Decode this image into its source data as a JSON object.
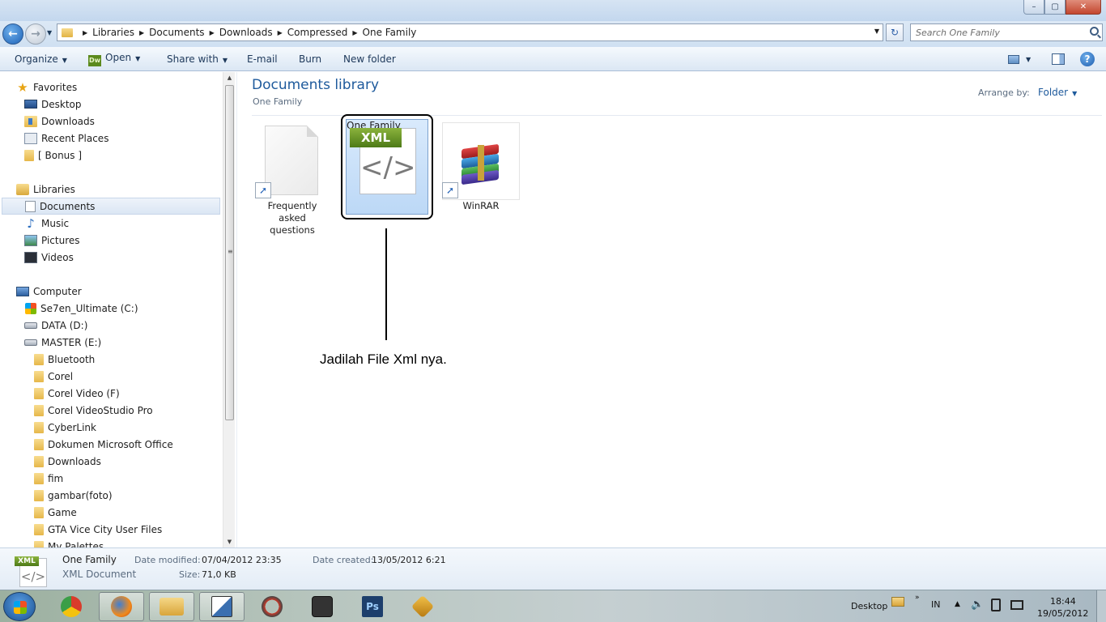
{
  "window": {
    "controls": {
      "minimize": "–",
      "maximize": "▢",
      "close": "✕"
    }
  },
  "address": {
    "breadcrumbs": [
      "Libraries",
      "Documents",
      "Downloads",
      "Compressed",
      "One Family"
    ],
    "search_placeholder": "Search One Family"
  },
  "toolbar": {
    "organize": "Organize",
    "open_icon_text": "Dw",
    "open": "Open",
    "share_with": "Share with",
    "email": "E-mail",
    "burn": "Burn",
    "new_folder": "New folder",
    "help": "?"
  },
  "sidebar": {
    "favorites": {
      "label": "Favorites",
      "items": [
        {
          "label": "Desktop",
          "icon": "desktop-icon"
        },
        {
          "label": "Downloads",
          "icon": "downloads-folder-icon"
        },
        {
          "label": "Recent Places",
          "icon": "recent-places-icon"
        },
        {
          "label": "[ Bonus ]",
          "icon": "folder-icon"
        }
      ]
    },
    "libraries": {
      "label": "Libraries",
      "items": [
        {
          "label": "Documents",
          "icon": "documents-icon",
          "selected": true
        },
        {
          "label": "Music",
          "icon": "music-icon"
        },
        {
          "label": "Pictures",
          "icon": "pictures-icon"
        },
        {
          "label": "Videos",
          "icon": "videos-icon"
        }
      ]
    },
    "computer": {
      "label": "Computer",
      "drives": [
        {
          "label": "Se7en_Ultimate (C:)",
          "icon": "windows-drive-icon"
        },
        {
          "label": "DATA (D:)",
          "icon": "drive-icon"
        },
        {
          "label": "MASTER (E:)",
          "icon": "drive-icon"
        }
      ],
      "folders": [
        "Bluetooth",
        "Corel",
        "Corel Video (F)",
        "Corel VideoStudio Pro",
        "CyberLink",
        "Dokumen Microsoft Office",
        "Downloads",
        "fim",
        "gambar(foto)",
        "Game",
        "GTA Vice City User Files",
        "My Palettes"
      ]
    }
  },
  "content": {
    "title": "Documents library",
    "subtitle": "One Family",
    "arrange_label": "Arrange by:",
    "arrange_value": "Folder",
    "files": [
      {
        "name": "Frequently asked questions",
        "line1": "Frequently asked",
        "line2": "questions",
        "icon": "blank-document-icon",
        "shortcut": true
      },
      {
        "name": "One Family",
        "icon": "xml-file-icon",
        "selected": true,
        "badge": "XML",
        "glyph": "</>"
      },
      {
        "name": "WinRAR",
        "icon": "winrar-icon",
        "shortcut": true
      }
    ],
    "annotation": "Jadilah File Xml nya."
  },
  "details": {
    "name": "One Family",
    "type": "XML Document",
    "badge": "XML",
    "glyph": "</>",
    "modified_label": "Date modified:",
    "modified_value": "07/04/2012 23:35",
    "created_label": "Date created:",
    "created_value": "13/05/2012 6:21",
    "size_label": "Size:",
    "size_value": "71,0 KB"
  },
  "taskbar": {
    "apps": [
      {
        "name": "Google Chrome",
        "icon": "chrome-icon",
        "color": "#d93b2b"
      },
      {
        "name": "Mozilla Firefox",
        "icon": "firefox-icon",
        "color": "#e06b1b"
      },
      {
        "name": "Windows Explorer",
        "icon": "explorer-icon",
        "color": "#e5b94a"
      },
      {
        "name": "Paint",
        "icon": "paint-icon",
        "color": "#3a6fb0"
      },
      {
        "name": "Nero",
        "icon": "nero-icon",
        "color": "#c83a2a"
      },
      {
        "name": "Media",
        "icon": "camera-icon",
        "color": "#333333"
      },
      {
        "name": "Photoshop",
        "icon": "photoshop-icon",
        "color": "#1d4f8c",
        "text": "Ps"
      },
      {
        "name": "Winamp",
        "icon": "winamp-icon",
        "color": "#e0a020"
      }
    ],
    "desktop_label": "Desktop",
    "language": "IN",
    "time": "18:44",
    "date": "19/05/2012"
  }
}
